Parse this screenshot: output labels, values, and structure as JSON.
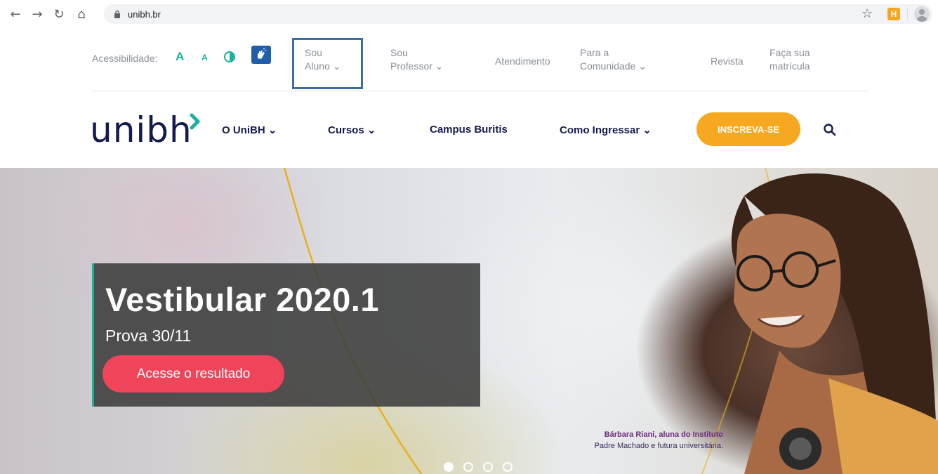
{
  "browser": {
    "url": "unibh.br",
    "icons": [
      "back-icon",
      "forward-icon",
      "reload-icon",
      "home-icon",
      "lock-icon",
      "star-icon",
      "extension-icon",
      "profile-icon"
    ],
    "extension_label": "H"
  },
  "utility_bar": {
    "accessibility_label": "Acessibilidade:",
    "font_increase": "A",
    "font_decrease": "A",
    "links": [
      {
        "line1": "Sou",
        "line2": "Aluno ⌄"
      },
      {
        "line1": "Sou",
        "line2": "Professor ⌄"
      },
      {
        "line1": "Atendimento",
        "line2": ""
      },
      {
        "line1": "Para a",
        "line2": "Comunidade ⌄"
      },
      {
        "line1": "Revista",
        "line2": ""
      },
      {
        "line1": "Faça sua",
        "line2": "matrícula"
      }
    ]
  },
  "main_nav": {
    "logo": "unibh",
    "items": [
      "O UniBH ⌄",
      "Cursos ⌄",
      "Campus Buritis",
      "Como Ingressar ⌄"
    ],
    "cta": "INSCREVA-SE"
  },
  "hero": {
    "title": "Vestibular 2020.1",
    "subtitle": "Prova 30/11",
    "button": "Acesse o resultado",
    "photo_caption_line1": "Bárbara Riani, aluna do Instituto",
    "photo_caption_line2": "Padre Machado e futura universitária.",
    "carousel_slides": 4,
    "active_slide": 1
  },
  "colors": {
    "navy": "#151b4f",
    "teal": "#1ab0a0",
    "orange": "#f6a821",
    "coral": "#f0445a",
    "highlight": "#3b6ea5"
  }
}
